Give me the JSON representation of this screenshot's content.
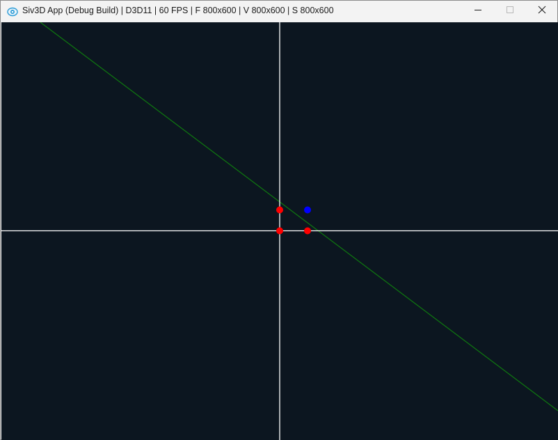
{
  "window": {
    "title": "Siv3D App (Debug Build) | D3D11 | 60 FPS | F 800x600 | V 800x600 | S 800x600",
    "app_icon": "siv3d-eye-icon",
    "buttons": {
      "minimize_icon": "minimize-icon",
      "maximize_icon": "maximize-icon",
      "close_icon": "close-icon"
    }
  },
  "canvas": {
    "background_color": "#0c1620",
    "axes_color": "#ffffff",
    "line_color": "#0f7a0f",
    "red_point_color": "#ff0000",
    "blue_point_color": "#0000ff"
  }
}
